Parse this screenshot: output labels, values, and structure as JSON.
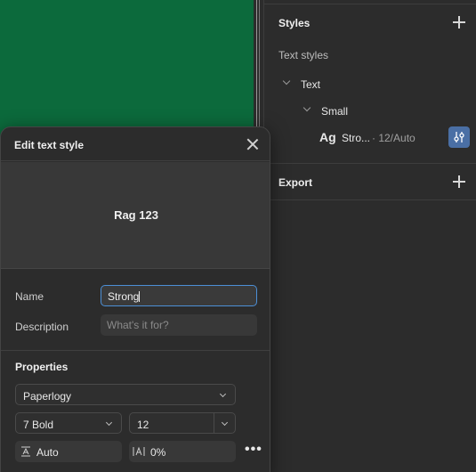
{
  "panel": {
    "styles_title": "Styles",
    "text_styles_label": "Text styles",
    "tree_text": "Text",
    "tree_small": "Small",
    "style_item": {
      "preview_glyph": "Ag",
      "name": "Stro...",
      "meta": "· 12/Auto"
    },
    "export_title": "Export"
  },
  "modal": {
    "title": "Edit text style",
    "preview_text": "Rag 123",
    "name_label": "Name",
    "name_value": "Strong",
    "description_label": "Description",
    "description_placeholder": "What's it for?",
    "properties_title": "Properties",
    "font_family": "Paperlogy",
    "font_weight": "7 Bold",
    "font_size": "12",
    "line_height": "Auto",
    "letter_spacing": "0%",
    "more_label": "•••"
  },
  "colors": {
    "canvas_frame": "#0c6a3c",
    "accent": "#4c8fd6",
    "edit_button": "#4a6fa5"
  }
}
